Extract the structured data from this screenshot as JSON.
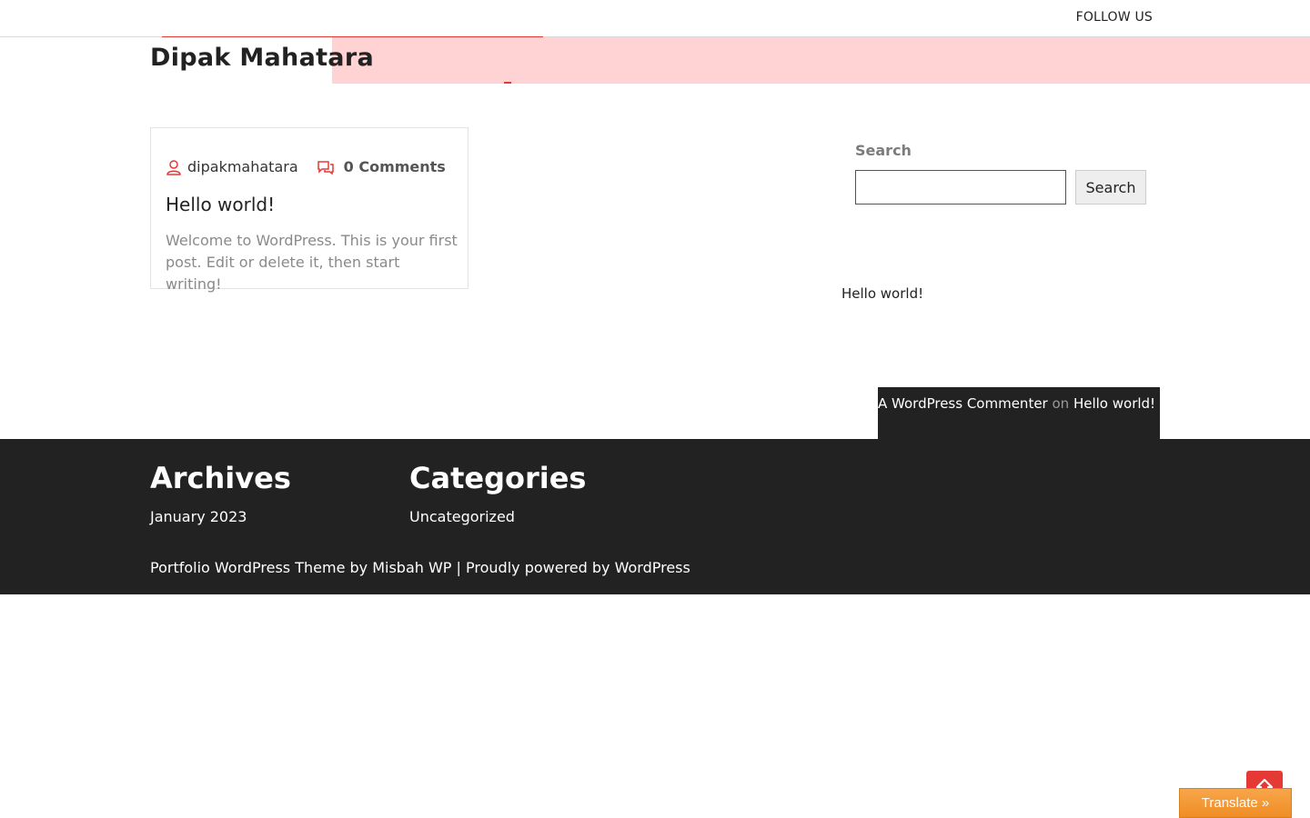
{
  "topbar": {
    "follow_label": "FOLLOW US"
  },
  "header": {
    "site_title": "Dipak Mahatara"
  },
  "post": {
    "author": "dipakmahatara",
    "comments": "0 Comments",
    "title": "Hello world!",
    "excerpt": "Welcome to WordPress. This is your first post. Edit or delete it, then start writing!"
  },
  "sidebar": {
    "search_label": "Search",
    "search_value": "",
    "search_button": "Search",
    "recent_post": "Hello world!",
    "recent_comment": {
      "author": "A WordPress Commenter",
      "on": "on",
      "post": "Hello world!"
    }
  },
  "footer": {
    "archives_title": "Archives",
    "archives_item": "January 2023",
    "categories_title": "Categories",
    "categories_item": "Uncategorized",
    "credits": "Portfolio WordPress Theme by Misbah WP | Proudly powered by WordPress"
  },
  "floating": {
    "translate_label": "Translate »"
  },
  "colors": {
    "accent": "#e53935",
    "footer_bg": "#222222",
    "header_band": "#ffd3d3",
    "translate": "#f09a34"
  },
  "icons": {
    "author": "user-icon",
    "comments": "comments-icon",
    "to_top": "arrow-up-icon"
  }
}
